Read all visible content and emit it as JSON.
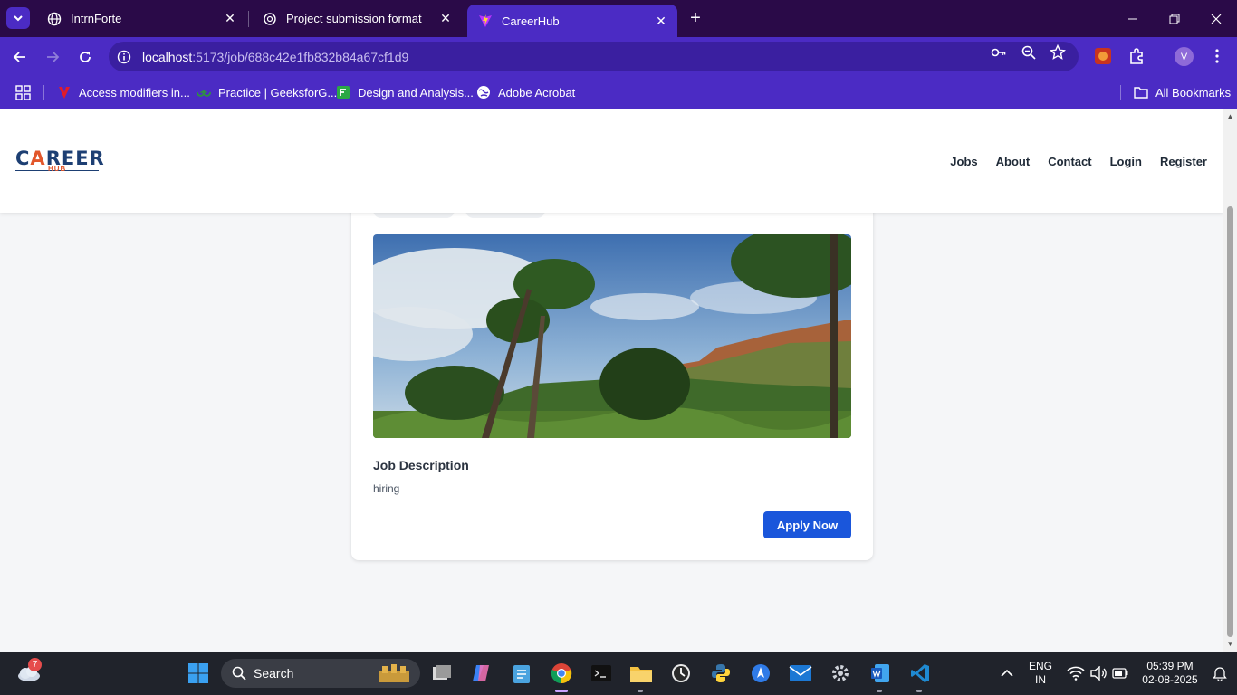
{
  "browser": {
    "tabs": [
      {
        "title": "IntrnForte",
        "active": false
      },
      {
        "title": "Project submission format",
        "active": false
      },
      {
        "title": "CareerHub",
        "active": true
      }
    ],
    "url_host": "localhost",
    "url_path": ":5173/job/688c42e1fb832b84a67cf1d9",
    "profile_initial": "V",
    "bookmarks": [
      {
        "label": "Access modifiers in..."
      },
      {
        "label": "Practice | GeeksforG..."
      },
      {
        "label": "Design and Analysis..."
      },
      {
        "label": "Adobe Acrobat"
      }
    ],
    "all_bookmarks": "All Bookmarks"
  },
  "site": {
    "logo_word_start": "C",
    "logo_word_a": "A",
    "logo_word_end": "REER",
    "logo_sub": "HUB",
    "nav": [
      "Jobs",
      "About",
      "Contact",
      "Login",
      "Register"
    ]
  },
  "job": {
    "description_heading": "Job Description",
    "description": "hiring",
    "apply_label": "Apply Now"
  },
  "taskbar": {
    "weather_badge": "7",
    "search_label": "Search",
    "lang_line1": "ENG",
    "lang_line2": "IN",
    "time": "05:39 PM",
    "date": "02-08-2025"
  },
  "colors": {
    "tab_strip": "#2a0a48",
    "browser_accent": "#4b2bc4",
    "apply_button": "#1a56db",
    "logo_navy": "#1d3f73",
    "logo_orange": "#e2572b"
  }
}
